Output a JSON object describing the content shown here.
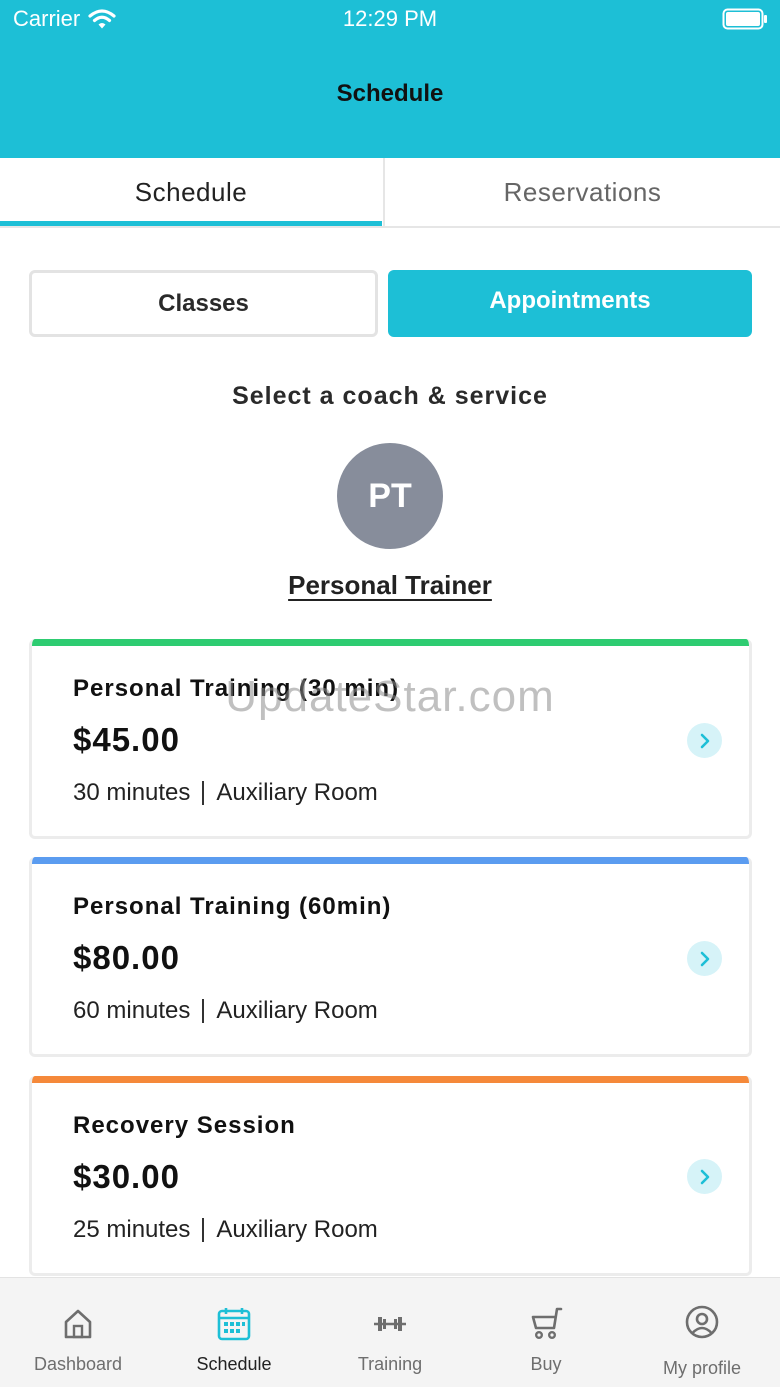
{
  "status_bar": {
    "carrier": "Carrier",
    "time": "12:29 PM"
  },
  "header": {
    "title": "Schedule"
  },
  "tabs": [
    {
      "label": "Schedule",
      "active": true
    },
    {
      "label": "Reservations",
      "active": false
    }
  ],
  "segments": {
    "classes": "Classes",
    "appointments": "Appointments",
    "selected": "Appointments"
  },
  "subtitle": "Select a coach & service",
  "coach": {
    "initials": "PT",
    "name": "Personal Trainer"
  },
  "services": [
    {
      "title": "Personal Training (30 min)",
      "price": "$45.00",
      "duration": "30 minutes",
      "location": "Auxiliary Room",
      "color": "#2ecc71"
    },
    {
      "title": "Personal Training (60min)",
      "price": "$80.00",
      "duration": "60 minutes",
      "location": "Auxiliary Room",
      "color": "#5b9cf0"
    },
    {
      "title": "Recovery Session",
      "price": "$30.00",
      "duration": "25 minutes",
      "location": "Auxiliary Room",
      "color": "#f5893a"
    }
  ],
  "watermark": "UpdateStar.com",
  "bottom_nav": [
    {
      "label": "Dashboard",
      "icon": "home-icon",
      "active": false
    },
    {
      "label": "Schedule",
      "icon": "calendar-icon",
      "active": true
    },
    {
      "label": "Training",
      "icon": "dumbbell-icon",
      "active": false
    },
    {
      "label": "Buy",
      "icon": "cart-icon",
      "active": false
    },
    {
      "label": "My profile",
      "icon": "user-circle-icon",
      "active": false
    }
  ],
  "colors": {
    "accent": "#1dbfd6",
    "avatar": "#878d9b",
    "chevron_bg": "#d6f3f8"
  }
}
